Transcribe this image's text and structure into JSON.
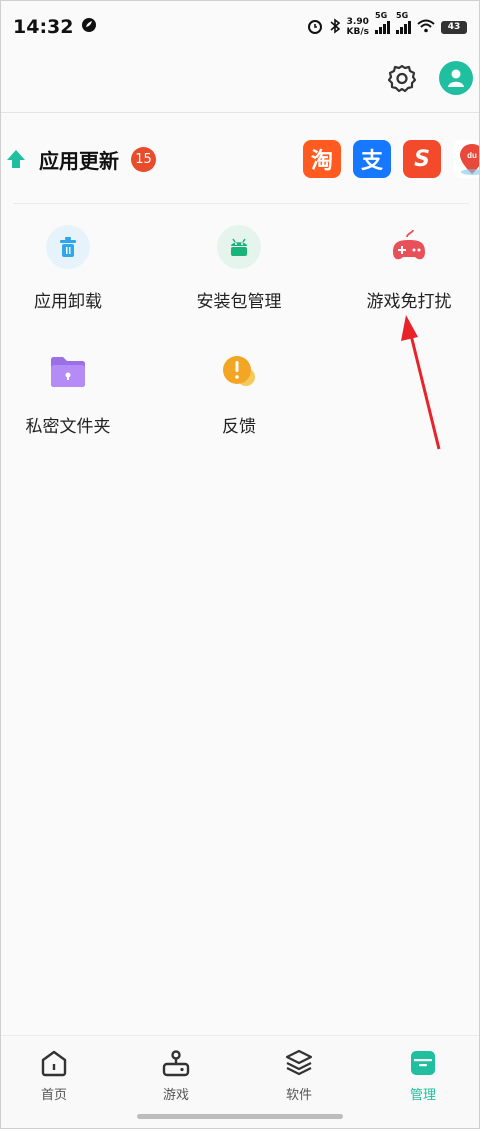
{
  "status_bar": {
    "time": "14:32",
    "net_speed_value": "3.90",
    "net_speed_unit": "KB/s",
    "sim1_label": "5G",
    "sim2_label": "5G",
    "battery": "43"
  },
  "update": {
    "title": "应用更新",
    "count": "15",
    "apps": [
      {
        "name": "taobao-icon",
        "glyph": "淘",
        "color": "#ff5a1f"
      },
      {
        "name": "alipay-icon",
        "glyph": "支",
        "color": "#1677ff"
      },
      {
        "name": "sogou-icon",
        "glyph": "S",
        "color": "#f24a2a"
      },
      {
        "name": "baidu-map-icon",
        "glyph": "du",
        "color": "#e8493a"
      }
    ]
  },
  "tools": [
    {
      "label": "应用卸载",
      "icon": "trash-icon"
    },
    {
      "label": "安装包管理",
      "icon": "android-icon"
    },
    {
      "label": "游戏免打扰",
      "icon": "gamepad-icon"
    },
    {
      "label": "私密文件夹",
      "icon": "lock-folder-icon"
    },
    {
      "label": "反馈",
      "icon": "feedback-icon"
    }
  ],
  "nav": {
    "items": [
      {
        "label": "首页",
        "icon": "home-icon",
        "active": false
      },
      {
        "label": "游戏",
        "icon": "joystick-icon",
        "active": false
      },
      {
        "label": "软件",
        "icon": "layers-icon",
        "active": false
      },
      {
        "label": "管理",
        "icon": "manage-icon",
        "active": true
      }
    ]
  },
  "colors": {
    "accent": "#1fbf9f",
    "badge": "#e84c2b",
    "annotation": "#e8232a"
  }
}
